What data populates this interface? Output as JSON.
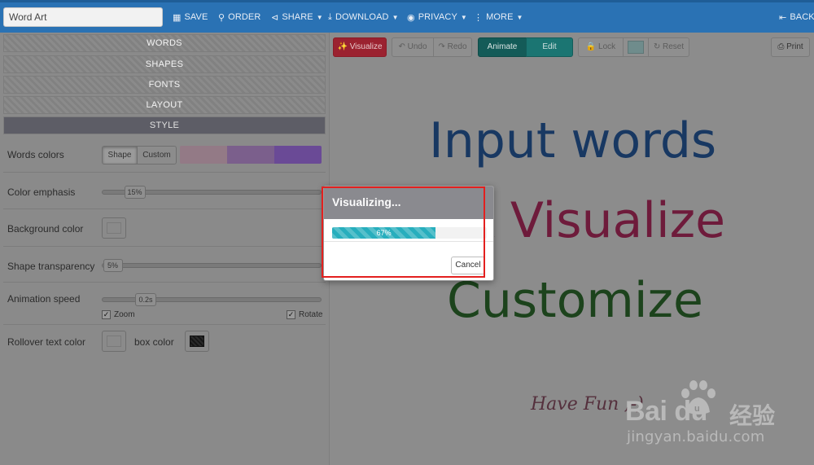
{
  "header": {
    "title_value": "Word Art",
    "nav": {
      "save": "SAVE",
      "order": "ORDER",
      "share": "SHARE",
      "download": "DOWNLOAD",
      "privacy": "PRIVACY",
      "more": "MORE",
      "back": "BACK"
    }
  },
  "sidebar": {
    "sections": [
      "WORDS",
      "SHAPES",
      "FONTS",
      "LAYOUT",
      "STYLE"
    ],
    "active_section": "STYLE",
    "style": {
      "words_colors_label": "Words colors",
      "shape_label": "Shape",
      "custom_label": "Custom",
      "swatch_colors": [
        "#937a86",
        "#7b5f8c",
        "#6a4a96"
      ],
      "color_emphasis_label": "Color emphasis",
      "color_emphasis_value": "15%",
      "color_emphasis_level": 0.15,
      "background_color_label": "Background color",
      "shape_transparency_label": "Shape transparency",
      "shape_transparency_value": "5%",
      "shape_transparency_level": 0.05,
      "animation_speed_label": "Animation speed",
      "animation_speed_value": "0.2s",
      "animation_speed_level": 0.2,
      "zoom_label": "Zoom",
      "zoom_checked": true,
      "rotate_label": "Rotate",
      "rotate_checked": true,
      "rollover_text_color_label": "Rollover text color",
      "box_color_label": "box color"
    }
  },
  "toolbar": {
    "visualize": "Visualize",
    "undo": "Undo",
    "redo": "Redo",
    "animate": "Animate",
    "edit": "Edit",
    "lock": "Lock",
    "reset": "Reset",
    "print": "Print",
    "shape_color": "#6f8c8c"
  },
  "canvas": {
    "words": [
      "Input words",
      "k Visualize",
      "Customize"
    ],
    "signature": "Have Fun ;-)"
  },
  "modal": {
    "title": "Visualizing...",
    "progress_percent": 67,
    "progress_label": "67%",
    "cancel": "Cancel"
  },
  "watermark": {
    "brand": "Bai  du",
    "chinese": "经验",
    "url": "jingyan.baidu.com"
  }
}
